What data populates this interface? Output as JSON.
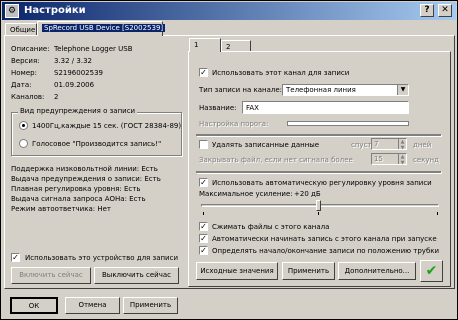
{
  "window": {
    "title": "Настройки",
    "help_glyph": "?",
    "close_glyph": "✕"
  },
  "tabs": {
    "general": "Общие",
    "device": "SpRecord USB Device [S2002539]"
  },
  "info": {
    "desc_label": "Описание:",
    "desc_value": "Telephone Logger USB",
    "version_label": "Версия:",
    "version_value": "3.32 / 3.32",
    "serial_label": "Номер:",
    "serial_value": "S2196002539",
    "date_label": "Дата:",
    "date_value": "01.09.2006",
    "channels_label": "Каналов:",
    "channels_value": "2"
  },
  "warning": {
    "legend": "Вид предупреждения о записи",
    "option1": "1400Гц,каждые 15 сек. (ГОСТ 28384-89)",
    "option2": "Голосовое \"Производится запись!\""
  },
  "features": [
    "Поддержка низковольтной линии: Есть",
    "Выдача предупреждения о записи: Есть",
    "Плавная регулировка уровня: Есть",
    "Выдача сигнала запроса АОНа: Есть",
    "Режим автоответчика: Нет"
  ],
  "use_device": {
    "label": "Использовать это устройство для записи",
    "checked": true
  },
  "left_buttons": {
    "enable": "Включить сейчас",
    "disable": "Выключить сейчас"
  },
  "channel_tabs": {
    "tab1": "1",
    "tab2": "2"
  },
  "channel": {
    "use_channel": "Использовать этот канал для записи",
    "line_type_label": "Тип записи на канале:",
    "line_type_value": "Телефонная линия",
    "name_label": "Название:",
    "name_value": "FAX",
    "threshold_label": "Настройка порога:",
    "delete_label": "Удалять записанные данные",
    "after_label": "спустя",
    "days_value": "7",
    "days_unit": "дней",
    "close_file_label": "Закрывать файл, если нет сигнала более",
    "seconds_value": "15",
    "seconds_unit": "секунд",
    "auto_level_label": "Использовать автоматическую регулировку уровня записи",
    "max_gain_label": "Максимальное усиление:",
    "max_gain_value": "+20 дБ",
    "compress_label": "Сжимать файлы с этого канала",
    "autostart_label": "Автоматически начинать запись с этого канала при запуске",
    "detect_label": "Определять начало/окончание записи по положению трубки"
  },
  "right_buttons": {
    "defaults": "Исходные значения",
    "apply": "Применить",
    "more": "Дополнительно...",
    "ok_mark": "✔"
  },
  "bottom_buttons": {
    "ok": "ОК",
    "cancel": "Отмена",
    "apply": "Применить"
  },
  "colors": {
    "titlebar_start": "#0a246a",
    "titlebar_end": "#a6caf0",
    "face": "#d4d0c8",
    "ok_check": "#1aa31a"
  }
}
